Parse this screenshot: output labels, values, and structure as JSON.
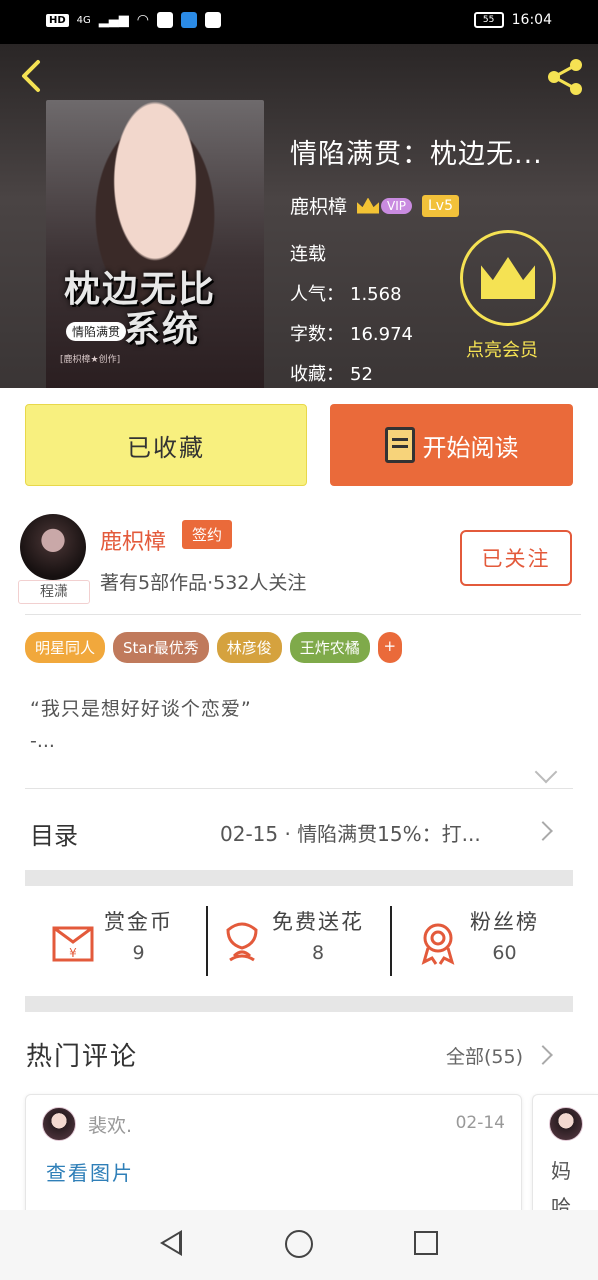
{
  "status_bar": {
    "left_chip": "HD",
    "network": "4G",
    "time": "16:04",
    "battery": "55"
  },
  "header": {
    "back_icon": "chevron-left-icon",
    "share_icon": "share-icon",
    "cover": {
      "title_line1": "枕边无比",
      "title_line2": "系统",
      "author_tag": "情陷满贯",
      "subtitle": "[鹿枳樟★创作]"
    },
    "book_title": "情陷满贯：枕边无...",
    "author": "鹿枳樟",
    "vip_label": "VIP",
    "level_label": "Lv5",
    "status": "连载",
    "stats": {
      "popularity_label": "人气：",
      "popularity": "1.568",
      "words_label": "字数：",
      "words": "16.974",
      "favorites_label": "收藏：",
      "favorites": "52"
    },
    "member_label": "点亮会员",
    "accent_color": "#f5e253"
  },
  "actions": {
    "collected_label": "已收藏",
    "read_label": "开始阅读"
  },
  "writer": {
    "avatar_tag": "程潇",
    "name": "鹿枳樟",
    "signed_label": "签约",
    "info": "著有5部作品·532人关注",
    "follow_label": "已关注"
  },
  "tags": [
    {
      "label": "明星同人",
      "color": "#f1a83c"
    },
    {
      "label": "Star最优秀",
      "color": "#c07a5c"
    },
    {
      "label": "林彦俊",
      "color": "#d5a23e"
    },
    {
      "label": "王炸农橘",
      "color": "#7faa4a"
    },
    {
      "label": "+",
      "color": "#ea6a3a"
    }
  ],
  "intro": {
    "line1": "“我只是想好好谈个恋爱”",
    "line2": "-..."
  },
  "toc": {
    "label": "目录",
    "latest": "02-15 · 情陷满贯15%：打..."
  },
  "support": [
    {
      "label": "赏金币",
      "count": "9",
      "icon": "red-envelope-icon"
    },
    {
      "label": "免费送花",
      "count": "8",
      "icon": "flower-icon"
    },
    {
      "label": "粉丝榜",
      "count": "60",
      "icon": "medal-icon"
    }
  ],
  "comments": {
    "title": "热门评论",
    "all_label": "全部(55)",
    "items": [
      {
        "user": "裴欢.",
        "date": "02-14",
        "content": "查看图片"
      },
      {
        "user": "",
        "date": "",
        "content": "妈",
        "extra": "哈"
      }
    ]
  }
}
